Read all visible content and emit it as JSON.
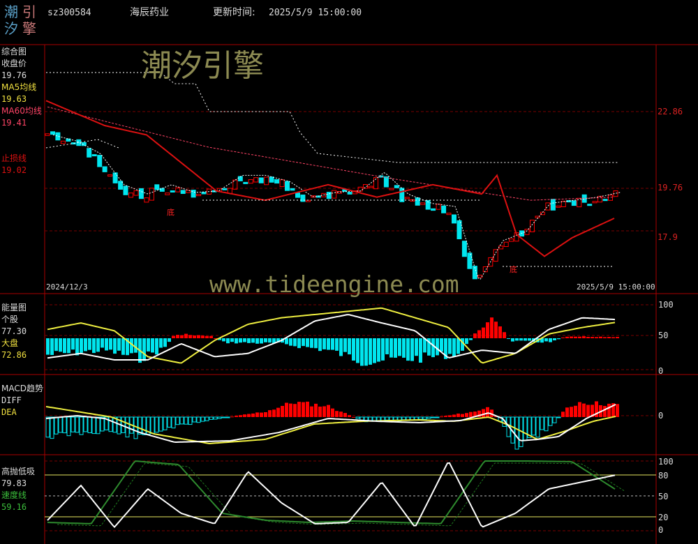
{
  "header": {
    "logo_chars": [
      "潮",
      "引",
      "汐",
      "擎"
    ],
    "code": "sz300584",
    "name": "海辰药业",
    "update_label": "更新时间:",
    "update_time": "2025/5/9 15:00:00"
  },
  "watermark": {
    "cn": "潮汐引擎",
    "url": "www.tideengine.com"
  },
  "colors": {
    "up": "#ff0000",
    "down": "#00e5ee",
    "ma5": "#ffffff",
    "ma60": "#ff4466",
    "stop": "#dd1111",
    "yellow": "#f0f040",
    "green": "#2e8b2e",
    "grid": "#7a0000"
  },
  "panels": {
    "main": {
      "title": "综合图",
      "close_label": "收盘价",
      "close_value": "19.76",
      "ma5_label": "MA5均线",
      "ma5_value": "19.63",
      "ma60_label": "MA60均线",
      "ma60_value": "19.41",
      "stop_label": "止损线",
      "stop_value": "19.02",
      "date_start": "2024/12/3",
      "date_end": "2025/5/9 15:00:00",
      "bottom_marks": [
        "底",
        "底"
      ]
    },
    "energy": {
      "title": "能量图",
      "stock_label": "个股",
      "stock_value": "77.30",
      "market_label": "大盘",
      "market_value": "72.86"
    },
    "macd": {
      "title": "MACD趋势",
      "diff_label": "DIFF",
      "dea_label": "DEA"
    },
    "hilo": {
      "title": "高抛低吸",
      "value": "79.83",
      "speed_label": "速度线",
      "speed_value": "59.16"
    }
  },
  "chart_data": [
    {
      "type": "candlestick",
      "title": "综合图",
      "yticks": [
        "22.86",
        "19.76",
        "17.9"
      ],
      "ylim": [
        16.6,
        24.6
      ],
      "close_start": 21.6,
      "close_end": 19.76,
      "close_min": 16.9,
      "close_max": 22.5,
      "series": [
        {
          "name": "收盘价",
          "values": [
            21.6,
            21.4,
            21.0,
            20.0,
            19.7,
            20.0,
            19.75,
            19.8,
            20.3,
            20.3,
            20.1,
            19.6,
            19.76,
            19.8,
            20.4,
            19.7,
            19.4,
            19.3,
            16.9,
            18.2,
            18.5,
            19.4,
            19.5,
            19.6,
            19.76
          ]
        },
        {
          "name": "MA5均线"
        },
        {
          "name": "MA60均线"
        },
        {
          "name": "止损线"
        }
      ]
    },
    {
      "type": "bar",
      "title": "能量图",
      "yticks": [
        0,
        50,
        100
      ],
      "ylim": [
        0,
        100
      ],
      "series": [
        {
          "name": "个股",
          "values": [
            18,
            25,
            15,
            15,
            40,
            20,
            25,
            45,
            75,
            85,
            72,
            60,
            18,
            30,
            25,
            62,
            80,
            77.3
          ]
        },
        {
          "name": "大盘",
          "values": [
            62,
            72,
            60,
            20,
            10,
            45,
            70,
            80,
            85,
            90,
            95,
            80,
            65,
            10,
            25,
            55,
            65,
            72.86
          ]
        }
      ]
    },
    {
      "type": "bar",
      "title": "MACD趋势",
      "yticks": [
        0
      ],
      "series": [
        {
          "name": "DIFF"
        },
        {
          "name": "DEA"
        }
      ]
    },
    {
      "type": "line",
      "title": "高抛低吸",
      "yticks": [
        0,
        20,
        50,
        80,
        100
      ],
      "ylim": [
        0,
        100
      ],
      "series": [
        {
          "name": "高抛低吸",
          "values": [
            15,
            65,
            5,
            60,
            25,
            10,
            85,
            40,
            10,
            12,
            70,
            5,
            100,
            5,
            25,
            60,
            70,
            79.83
          ]
        },
        {
          "name": "速度线",
          "values": [
            12,
            10,
            100,
            95,
            25,
            15,
            12,
            14,
            12,
            10,
            100,
            100,
            99,
            59.16
          ]
        }
      ]
    }
  ]
}
